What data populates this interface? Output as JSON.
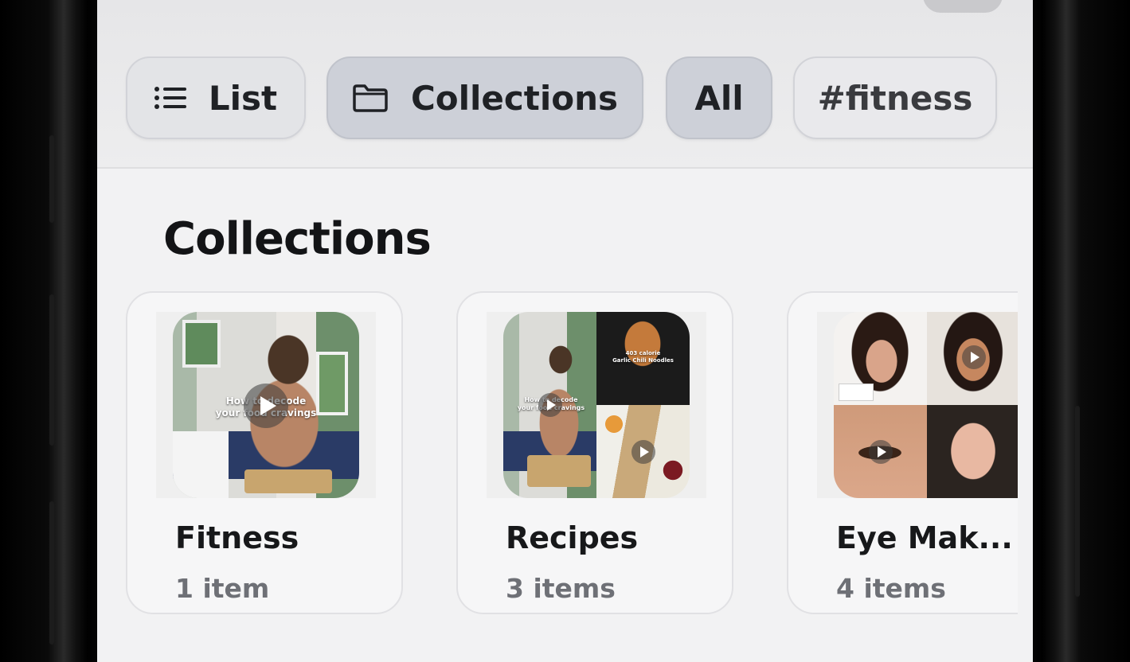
{
  "filters": {
    "list_label": "List",
    "collections_label": "Collections",
    "all_label": "All",
    "tag_label": "#fitness"
  },
  "section": {
    "title": "Collections"
  },
  "collections": [
    {
      "title": "Fitness",
      "count": "1 item",
      "overlay": [
        "How to decode",
        "your food cravings"
      ]
    },
    {
      "title": "Recipes",
      "count": "3 items",
      "overlay": [
        "How to decode",
        "your food cravings"
      ],
      "overlay2": [
        "403 calorie",
        "Garlic Chili Noodles"
      ]
    },
    {
      "title": "Eye Mak...",
      "count": "4 items"
    }
  ],
  "colors": {
    "screen_bg": "#f2f2f3",
    "chip_active": "#cdd0d8",
    "text_primary": "#17181a",
    "text_secondary": "#6e7076"
  }
}
